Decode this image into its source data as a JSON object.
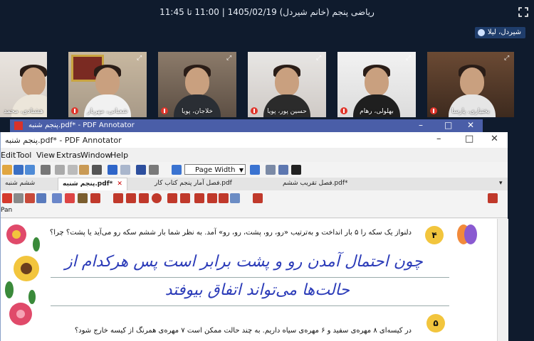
{
  "meeting": {
    "title": "ریاضی پنجم (خانم شیردل) 1405/02/19 | 11:00 تا 11:45",
    "presenter": "شیردل، لیلا"
  },
  "participants": [
    {
      "name": "هشتادی، محمد"
    },
    {
      "name": "شعبانی، مهریار"
    },
    {
      "name": "خلاجان، پویا"
    },
    {
      "name": "حسین پور، پویا"
    },
    {
      "name": "بهلولی، رهام"
    },
    {
      "name": "بختیاری، پارسا"
    }
  ],
  "app_strip": {
    "title": "پنجم شنبه.pdf* - PDF Annotator"
  },
  "window": {
    "title": "پنجم شنبه.pdf* - PDF Annotator",
    "menu": [
      "Edit",
      "Tool",
      "View",
      "Extras",
      "Window",
      "Help"
    ],
    "zoom": "Page Width",
    "tabs": [
      {
        "label": "ششم شنبه"
      },
      {
        "label": "پنجم شنبه.pdf*"
      },
      {
        "label": "فصل آمار پنجم کتاب کار.pdf"
      },
      {
        "label": "فصل تقریب ششم.pdf*"
      }
    ],
    "tool_label": "Pan"
  },
  "document": {
    "q4_number": "۴",
    "q4_text": "دلنواز یک سکه را ۵ بار انداخت و به‌ترتیب «رو، رو، پشت، رو، رو» آمد. به نظر شما بار ششم سکه رو می‌آید یا پشت؟ چرا؟",
    "answer_line1": "چون احتمال آمدن رو و پشت برابر است پس هرکدام از",
    "answer_line2": "حالت‌ها می‌تواند اتفاق بیوفتد",
    "q5_number": "۵",
    "q5_text": "در کیسه‌ای ۸ مهره‌ی سفید و ۶ مهره‌ی سیاه داریم. به چند حالت ممکن است ۷ مهره‌ی همرنگ از کیسه خارج شود؟"
  }
}
